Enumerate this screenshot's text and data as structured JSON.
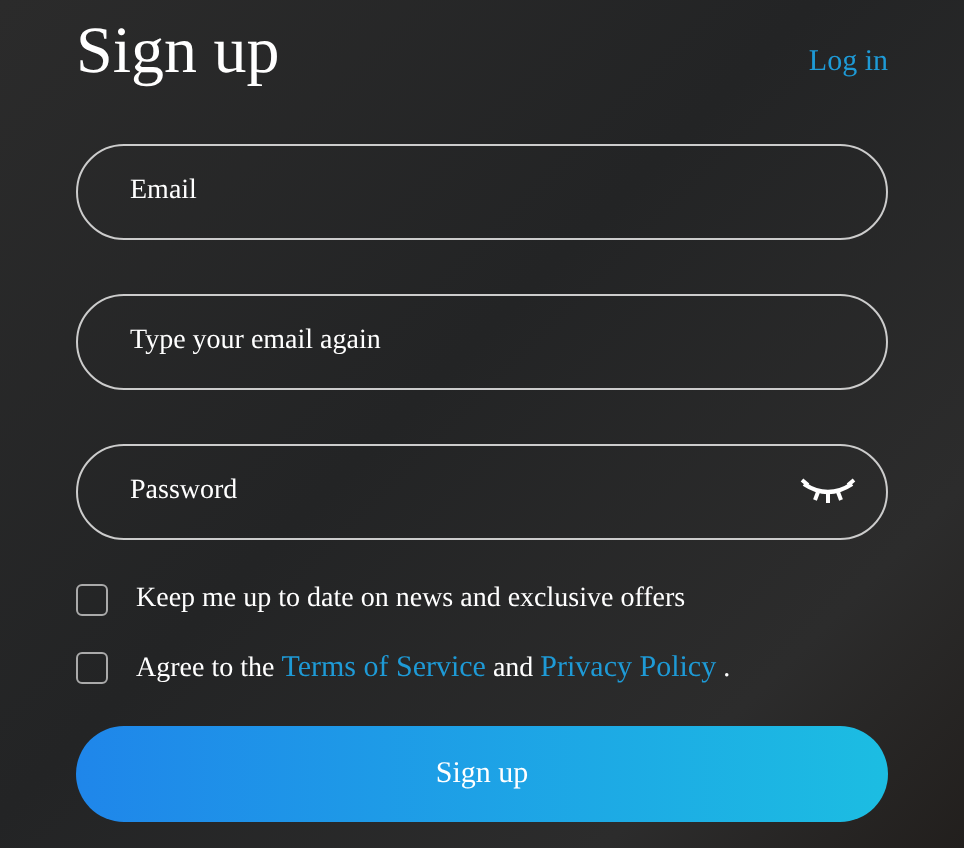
{
  "title": "Sign up",
  "login_link": "Log in",
  "fields": [
    {
      "placeholder": "Email",
      "kind": "text"
    },
    {
      "placeholder": "Type your email again",
      "kind": "text"
    },
    {
      "placeholder": "Password",
      "kind": "password"
    }
  ],
  "checkboxes": [
    {
      "checked": false,
      "parts": [
        {
          "kind": "text",
          "text": "Keep me up to date on news and exclusive offers"
        }
      ]
    },
    {
      "checked": false,
      "parts": [
        {
          "kind": "text",
          "text": "Agree to the "
        },
        {
          "kind": "link",
          "text": "Terms of Service"
        },
        {
          "kind": "text",
          "text": " and "
        },
        {
          "kind": "link",
          "text": "Privacy Policy"
        },
        {
          "kind": "text",
          "text": " ."
        }
      ]
    }
  ],
  "submit": "Sign up"
}
